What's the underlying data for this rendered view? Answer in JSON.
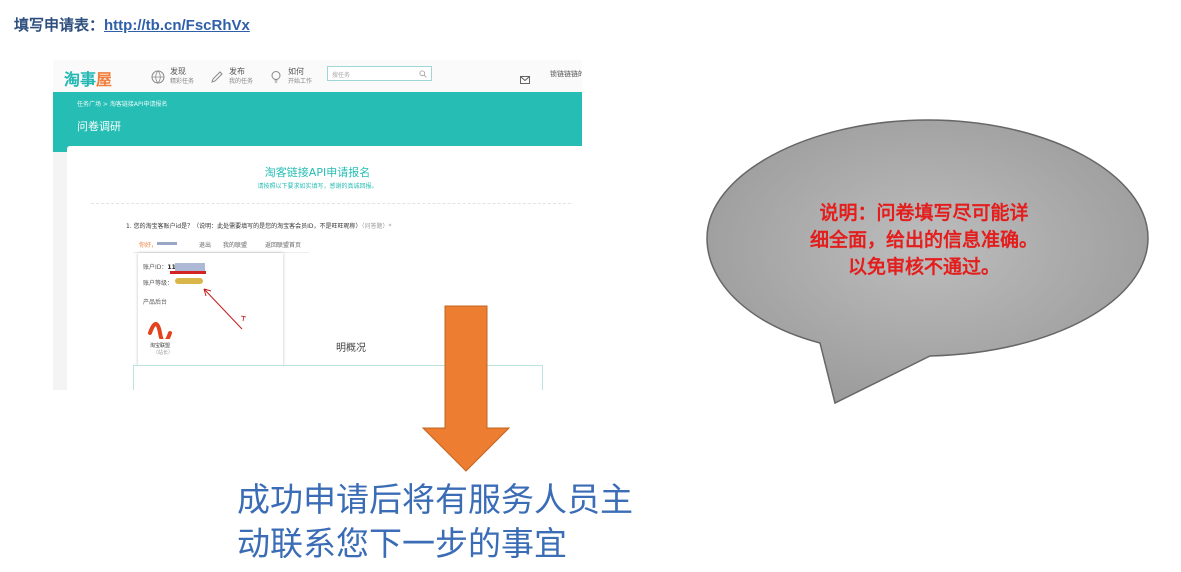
{
  "header": {
    "label": "填写申请表：",
    "link": "http://tb.cn/FscRhVx"
  },
  "screenshot": {
    "logo": "淘事屋",
    "nav": [
      {
        "main": "发现",
        "sub": "精彩任务",
        "icon": "globe-icon"
      },
      {
        "main": "发布",
        "sub": "我的任务",
        "icon": "pencil-icon"
      },
      {
        "main": "如何",
        "sub": "开始工作",
        "icon": "lightbulb-icon"
      }
    ],
    "search_placeholder": "搜任务",
    "user_name": "锁链链链的",
    "breadcrumb": "任务广场 > 淘客链接API申请报名",
    "page_title": "问卷调研",
    "form_title": "淘客链接API申请报名",
    "form_subtitle": "请按照以下要求如实填写，感谢的真诚回报。",
    "question": "1. 您的淘宝客账户id是？（说明：此处需要填写的是您的淘宝客会员ID，不是旺旺昵称）",
    "question_required": "（问答题）*",
    "inner": {
      "hello": "你好，",
      "logout": "退出",
      "my_alliance": "我的联盟",
      "back_home": "返回联盟首页",
      "account_id_label": "账户ID：",
      "account_id_value": "1113",
      "account_level_label": "账户等级：",
      "product_label": "产品后台",
      "alliance_name": "淘宝联盟",
      "alliance_sub": "（站长）",
      "partial_right": "明概况"
    }
  },
  "bubble": {
    "lines": [
      "说明：问卷填写尽可能详",
      "细全面，给出的信息准确。",
      "以免审核不通过。"
    ]
  },
  "bottom": {
    "lines": [
      "成功申请后将有服务人员主",
      "动联系您下一步的事宜"
    ]
  },
  "colors": {
    "teal": "#26bdb5",
    "arrow_orange": "#ed7d31",
    "bubble_gray": "#a6a6a6",
    "note_red": "#e41d1d",
    "bottom_blue": "#3b6cb6"
  }
}
